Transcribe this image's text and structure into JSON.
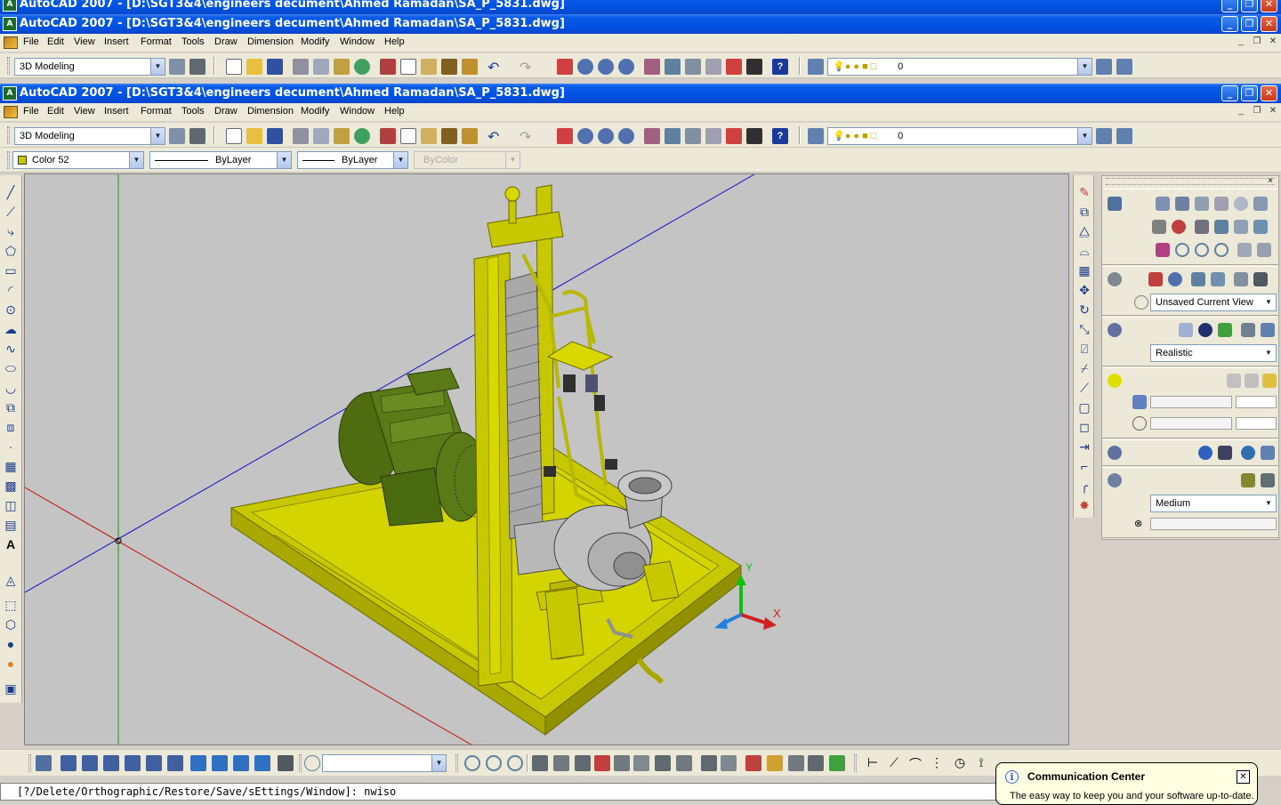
{
  "background_window": {
    "title": "AutoCAD 2007 - [D:\\SGT3&4\\engineers decument\\Ahmed Ramadan\\SA_P_5831.dwg]",
    "title_partial": "AutoCAD 2007 - [D:\\SGT3&4\\engineers decument\\Ahmed Ramadan\\SA_P_5831.dwg]"
  },
  "window": {
    "title": "AutoCAD 2007 - [D:\\SGT3&4\\engineers decument\\Ahmed Ramadan\\SA_P_5831.dwg]",
    "minimize": "_",
    "restore": "❐",
    "close": "✕"
  },
  "menu": {
    "items": [
      "File",
      "Edit",
      "View",
      "Insert",
      "Format",
      "Tools",
      "Draw",
      "Dimension",
      "Modify",
      "Window",
      "Help"
    ],
    "mdi_minimize": "_",
    "mdi_restore": "❐",
    "mdi_close": "✕"
  },
  "toolbar": {
    "workspace": "3D Modeling",
    "layer": "0"
  },
  "properties": {
    "color": "Color 52",
    "linetype": "ByLayer",
    "lineweight": "ByLayer",
    "plotstyle": "ByColor"
  },
  "dashboard": {
    "view": "Unsaved Current View",
    "visual_style": "Realistic",
    "render_quality": "Medium"
  },
  "viewport": {
    "ucs_y": "Y",
    "ucs_x": "X"
  },
  "command_line": {
    "text": "[?/Delete/Orthographic/Restore/Save/sEttings/Window]:  nwiso"
  },
  "balloon": {
    "title": "Communication Center",
    "text": "The easy way to keep you and your software up-to-date.",
    "close": "✕",
    "info": "i"
  },
  "colors": {
    "model_yellow": "#c8c800",
    "motor_green": "#5a7a18",
    "pump_grey": "#b8b8b8",
    "viewport_bg": "#c4c4c4"
  }
}
